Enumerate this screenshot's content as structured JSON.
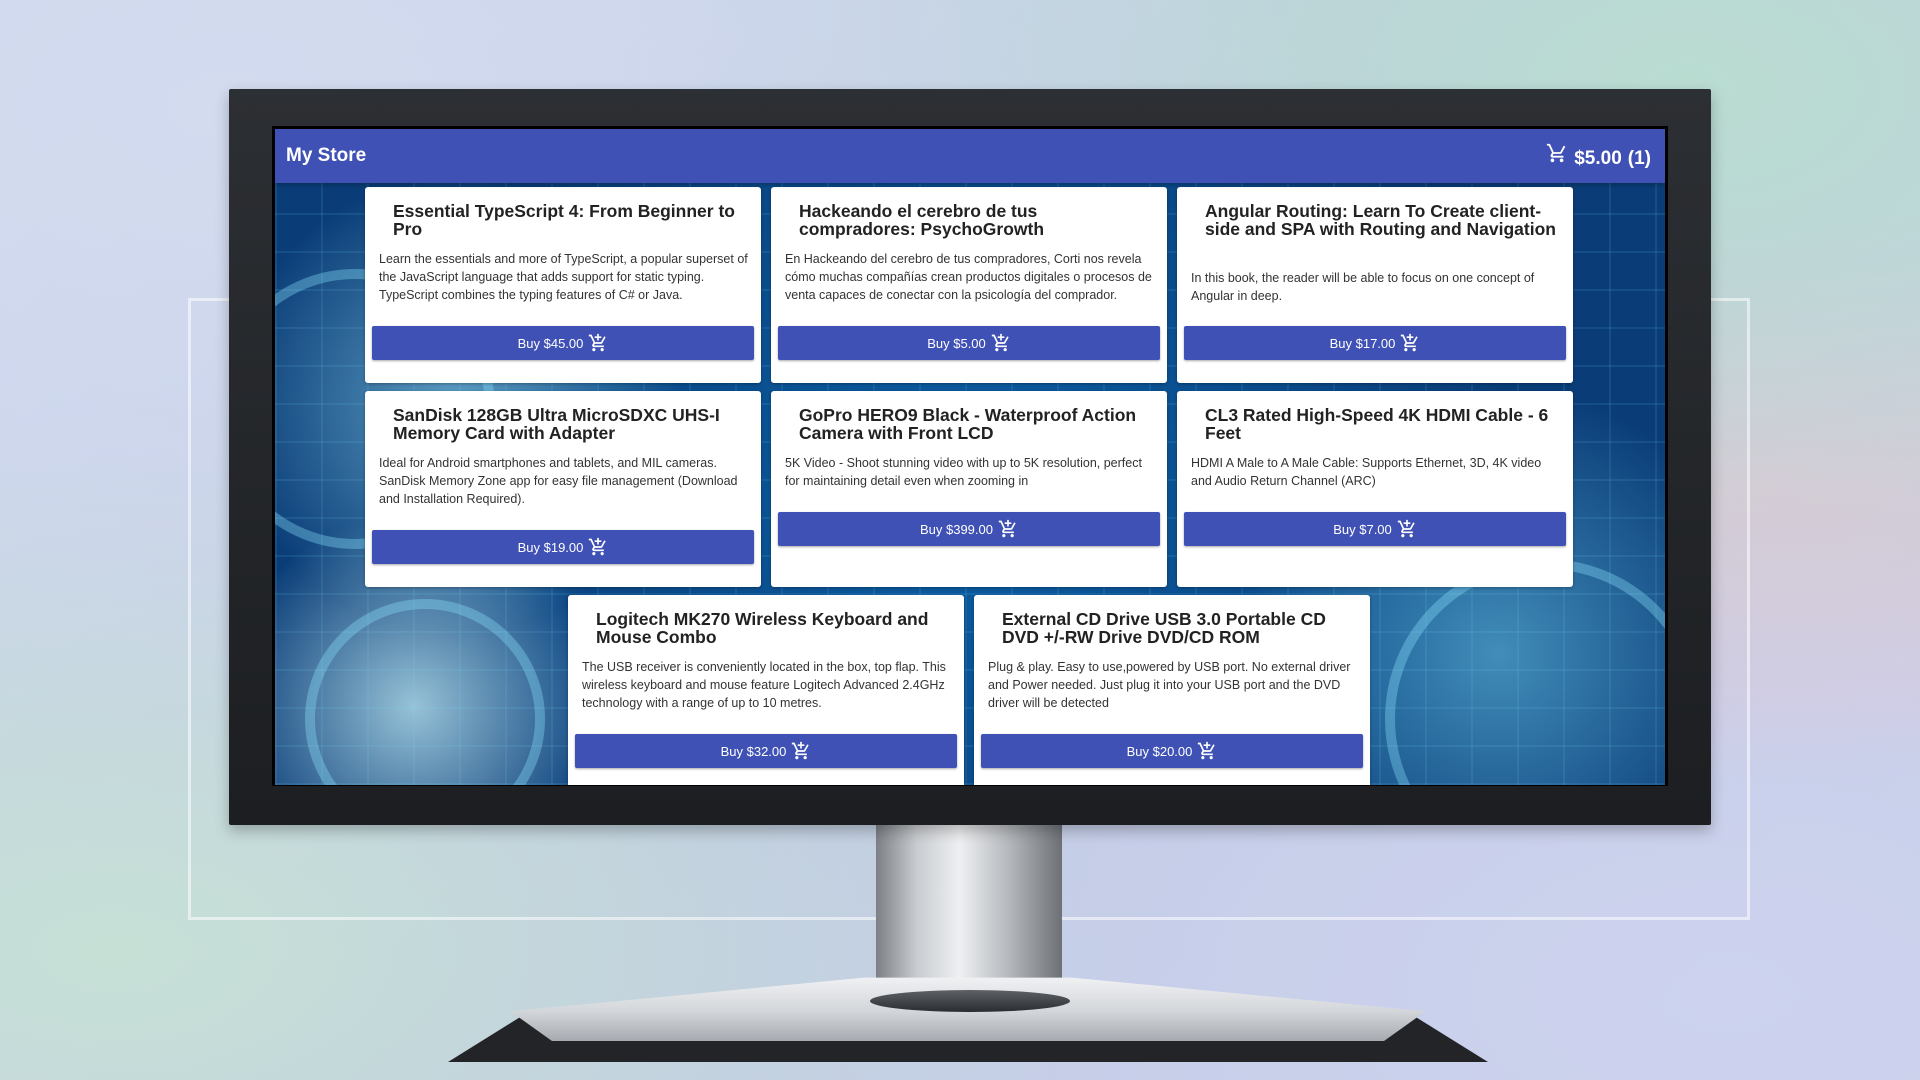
{
  "store": {
    "title": "My Store",
    "cart_total": "$5.00",
    "cart_count": "(1)"
  },
  "products": [
    {
      "title": "Essential TypeScript 4: From Beginner to Pro",
      "description": "Learn the essentials and more of TypeScript, a popular superset of the JavaScript language that adds support for static typing. TypeScript combines the typing features of C# or Java.",
      "buy_label": "Buy $45.00"
    },
    {
      "title": "Hackeando el cerebro de tus compradores: PsychoGrowth",
      "description": "En Hackeando del cerebro de tus compradores, Corti nos revela cómo muchas compañías crean productos digitales o procesos de venta capaces de conectar con la psicología del comprador.",
      "buy_label": "Buy $5.00"
    },
    {
      "title": "Angular Routing: Learn To Create client-side and SPA with Routing and Navigation",
      "description": "In this book, the reader will be able to focus on one concept of Angular in deep.",
      "buy_label": "Buy $17.00"
    },
    {
      "title": "SanDisk 128GB Ultra MicroSDXC UHS-I Memory Card with Adapter",
      "description": "Ideal for Android smartphones and tablets, and MIL cameras. SanDisk Memory Zone app for easy file management (Download and Installation Required).",
      "buy_label": "Buy $19.00"
    },
    {
      "title": "GoPro HERO9 Black - Waterproof Action Camera with Front LCD",
      "description": "5K Video - Shoot stunning video with up to 5K resolution, perfect for maintaining detail even when zooming in",
      "buy_label": "Buy $399.00"
    },
    {
      "title": "CL3 Rated High-Speed 4K HDMI Cable - 6 Feet",
      "description": "HDMI A Male to A Male Cable: Supports Ethernet, 3D, 4K video and Audio Return Channel (ARC)",
      "buy_label": "Buy $7.00"
    },
    {
      "title": "Logitech MK270 Wireless Keyboard and Mouse Combo",
      "description": "The USB receiver is conveniently located in the box, top flap. This wireless keyboard and mouse feature Logitech Advanced 2.4GHz technology with a range of up to 10 metres.",
      "buy_label": "Buy $32.00"
    },
    {
      "title": "External CD Drive USB 3.0 Portable CD DVD +/-RW Drive DVD/CD ROM",
      "description": "Plug & play. Easy to use,powered by USB port. No external driver and Power needed. Just plug it into your USB port and the DVD driver will be detected",
      "buy_label": "Buy $20.00"
    }
  ],
  "colors": {
    "primary": "#3f51b5",
    "card_bg": "#ffffff"
  },
  "icons": {
    "cart": "shopping-cart-icon",
    "add_to_cart": "add-shopping-cart-icon"
  }
}
